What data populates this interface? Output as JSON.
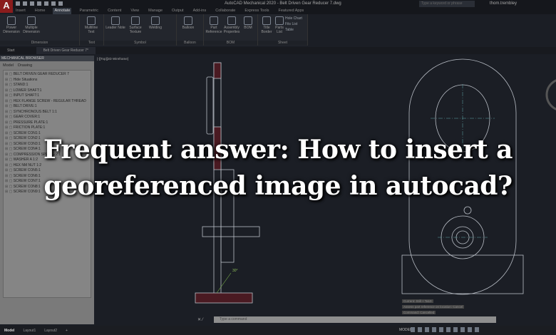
{
  "app": {
    "logo": "A",
    "title": "AutoCAD Mechanical 2020 - Belt Driven Gear Reducer 7.dwg",
    "search_placeholder": "Type a keyword or phrase",
    "user": "thom.trembley"
  },
  "ribbon_tabs": [
    "Insert",
    "Home",
    "Annotate",
    "Parametric",
    "Content",
    "View",
    "Manage",
    "Output",
    "Add-ins",
    "Collaborate",
    "Express Tools",
    "Featured Apps"
  ],
  "panels": [
    {
      "title": "Dimension",
      "tools": [
        "Power Dimension",
        "Multiple Dimension"
      ]
    },
    {
      "title": "Text",
      "tools": [
        "Multiline Text"
      ]
    },
    {
      "title": "Symbol",
      "tools": [
        "Leader Note",
        "Surface Texture",
        "Welding"
      ]
    },
    {
      "title": "Balloon",
      "tools": [
        "Balloon"
      ]
    },
    {
      "title": "BOM",
      "tools": [
        "Part Reference",
        "Assembly Properties",
        "BOM"
      ]
    },
    {
      "title": "Sheet",
      "tools": [
        "Title Border",
        "Parts List"
      ],
      "small": [
        "Hole Chart",
        "Fits List",
        "Table"
      ]
    }
  ],
  "doc_tabs": [
    "Start",
    "Belt Driven Gear Reducer 7*"
  ],
  "browser": {
    "header": "MECHANICAL BROWSER",
    "tabs": [
      "Model",
      "Drawing"
    ],
    "items": [
      "BELT DRIVEN GEAR REDUCER 7",
      "Hide Situations",
      "STAND:1",
      "LOWER SHAFT:1",
      "INPUT SHAFT:1",
      "HEX FLANGE SCREW - REGULAR THREAD",
      "BELT DRIVE:1",
      "SYNCHRONOUS BELT 1:1",
      "GEAR COVER:1",
      "PRESSURE PLATE:1",
      "FRICTION PLATE:1",
      "SCREW CON1:1",
      "SCREW CON2:1",
      "SCREW CON3:1",
      "SCREW CON4:1",
      "COMPRESSION SPRING:2:1",
      "WASHER A 1:2",
      "HEX NM NUT 1:2",
      "SCREW CON5:1",
      "SCREW CON6:1",
      "SCREW CON7:1",
      "SCREW CON8:1",
      "SCREW CON9:1"
    ]
  },
  "viewport_label": "[-][Top][2D Wireframe]",
  "drawing": {
    "annotation": "30°"
  },
  "command": {
    "placeholder": "Type a command",
    "history": [
      "Current: Still + Ta10",
      "Assess part reference on location: Cancel",
      "Command: Cancelled"
    ]
  },
  "layouts": [
    "Model",
    "Layout1",
    "Layout2",
    "+"
  ],
  "status": {
    "model": "MODEL"
  },
  "headline": [
    "Frequent answer: How to insert a",
    "georeferenced image in autocad?"
  ]
}
